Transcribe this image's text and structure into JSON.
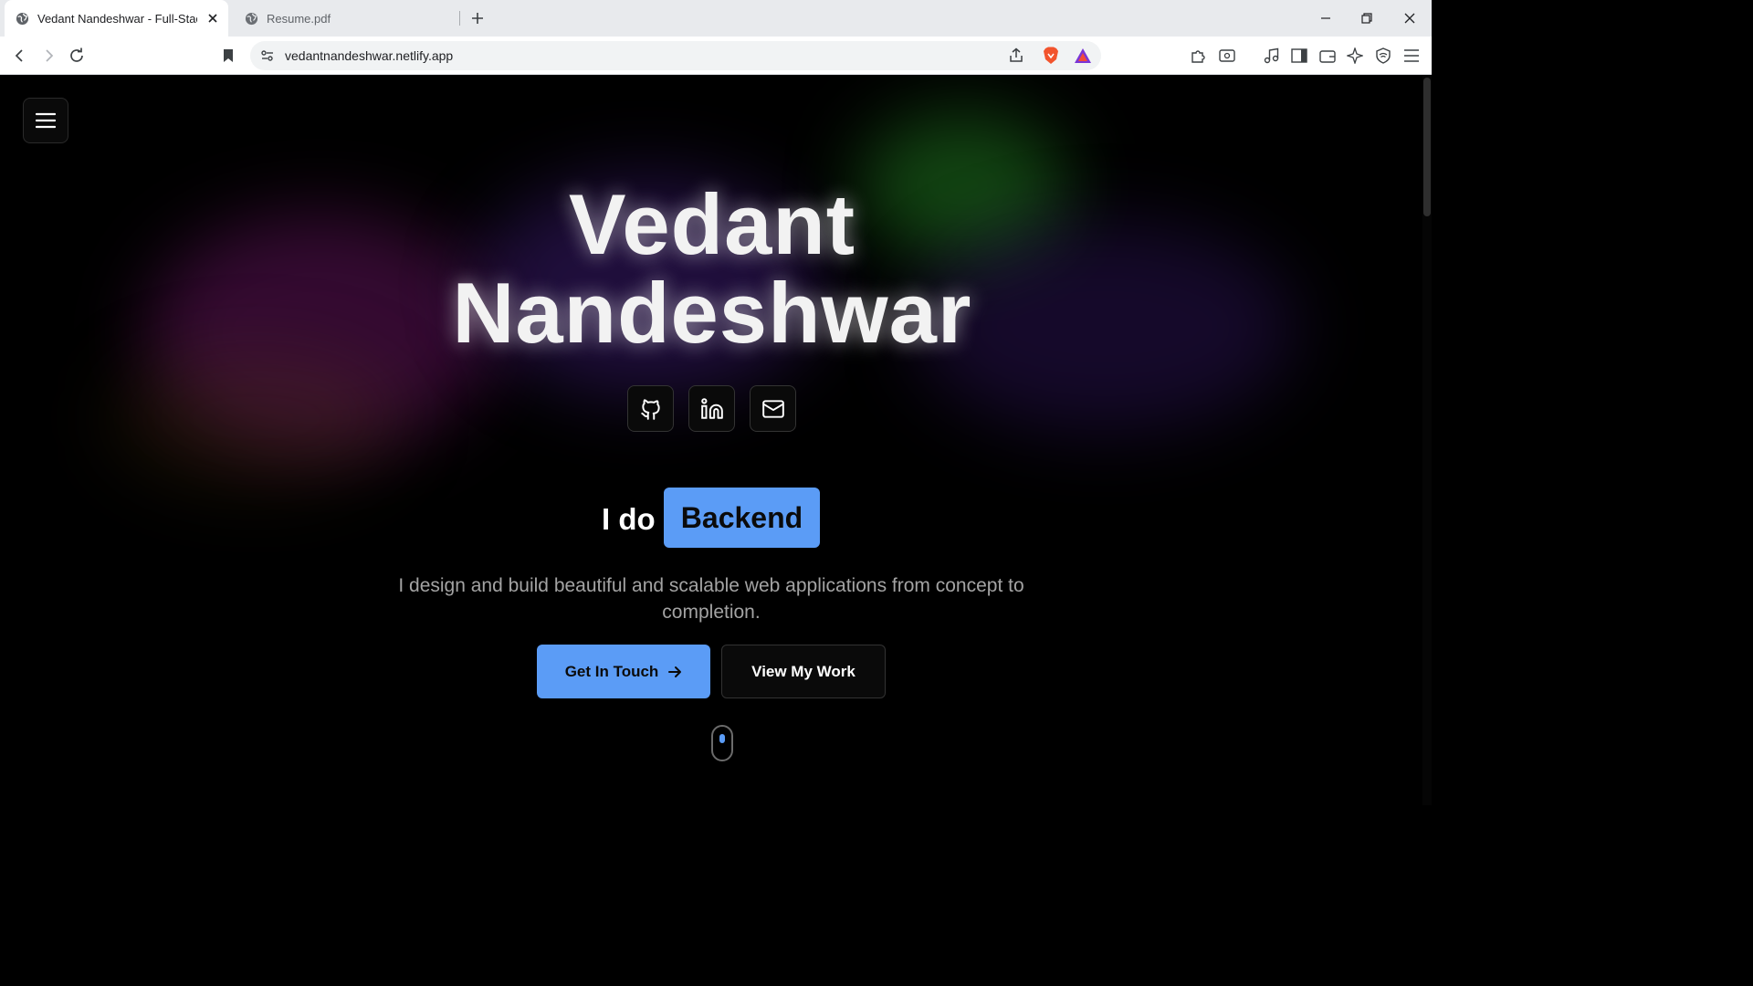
{
  "browser": {
    "tabs": [
      {
        "title": "Vedant Nandeshwar - Full-Stack Developer",
        "active": true,
        "icon": "globe-icon"
      },
      {
        "title": "Resume.pdf",
        "active": false,
        "icon": "globe-icon"
      }
    ],
    "url": "vedantnandeshwar.netlify.app"
  },
  "hero": {
    "name_line1": "Vedant",
    "name_line2": "Nandeshwar",
    "intro": "I do",
    "role": "Backend",
    "tagline": "I design and build beautiful and scalable web applications from concept to completion.",
    "primary_cta": "Get In Touch",
    "secondary_cta": "View My Work"
  },
  "social_links": [
    "github-icon",
    "linkedin-icon",
    "mail-icon"
  ],
  "colors": {
    "accent": "#5b9cf6",
    "background": "#000000",
    "muted_text": "#a3a3a3"
  }
}
